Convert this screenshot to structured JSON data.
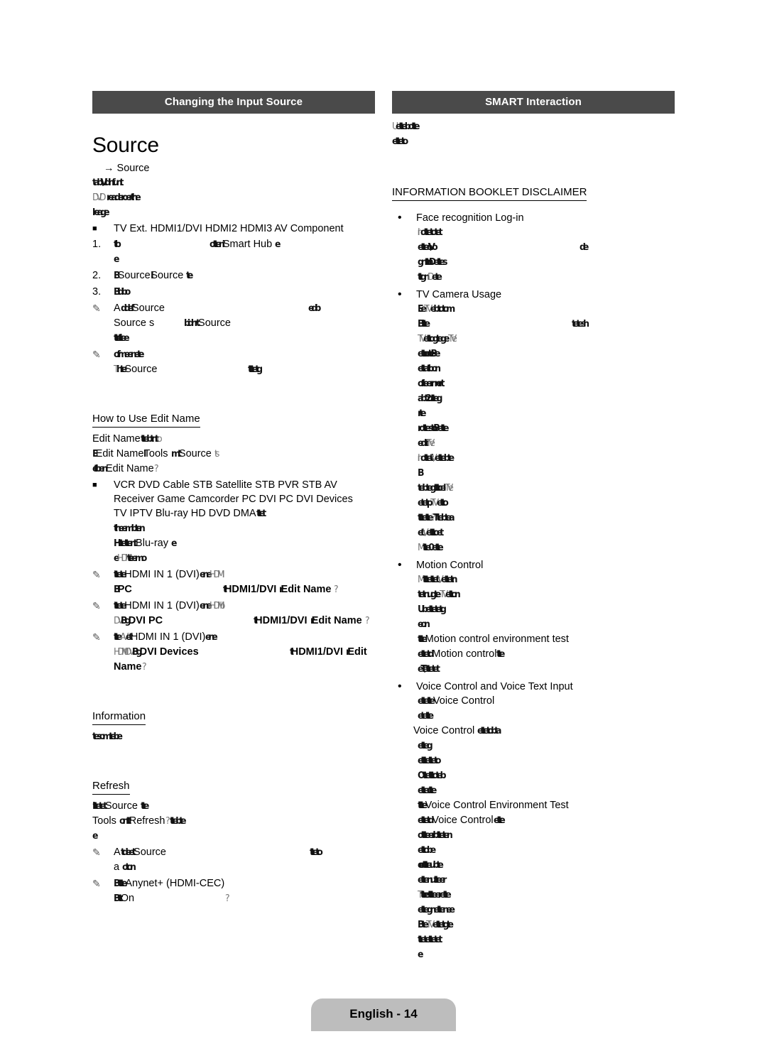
{
  "page": {
    "footer_label": "English - 14",
    "header_bg": "#4a4a4a",
    "footer_bg": "#bdbdbd"
  },
  "left_column": {
    "section_title": "Changing the Input Source",
    "page_title": "Source",
    "menu_path": "→ Source",
    "garbled_intro": [
      "tab\\Vidinfunt",
      "readeroerthe",
      "lreage"
    ],
    "garbled_intro_prefixes": [
      "",
      "DVD",
      ""
    ],
    "source_list_bullet": "■",
    "source_list": "TV  Ext.  HDMI1/DVI  HDMI2  HDMI3  AV      Component",
    "steps": [
      {
        "num": "1.",
        "text_before": "",
        "garble_a": "tb",
        "garble_b": "otteni",
        "text_mid": "Smart Hub",
        "garble_c": "e",
        "sub_garble": "e"
      },
      {
        "num": "2.",
        "garble_a": "B",
        "text_a": "Source",
        "garble_b": "I",
        "text_b": "Source",
        "garble_c": "te"
      },
      {
        "num": "3.",
        "garble_a": "Bidibo"
      }
    ],
    "notes": [
      {
        "icon": "pencil-icon",
        "line1_pre": "A",
        "line1_garble": "ddef",
        "line1_text": "Source",
        "line1_tail_garble": "edb",
        "line2_pre": "Source s",
        "line2_garble": "bidnrt",
        "line2_text": "Source",
        "line3_garble": "ttei ttee"
      },
      {
        "icon": "pencil-icon",
        "line1_garble": "ofmeenete",
        "line2_pre_garble": "T",
        "line2_garble": "hte",
        "line2_text": "Source",
        "line2_tail_garble": "tttetg"
      }
    ],
    "edit_name": {
      "heading": "How to Use Edit Name",
      "line1_text": "Edit Name",
      "line1_garble": "ttebtnt",
      "line1_tail": "o",
      "line2_garble_a": "E",
      "line2_text_a": "Edit Name",
      "line2_garble_b": "l",
      "line2_text_b": "Tools",
      "line2_garble_c": "mt",
      "line2_text_c": "Source",
      "line2_garble_d": "ts",
      "line3_garble_a": "el tben",
      "line3_text": "Edit Name",
      "line3_garble_b": "?",
      "bullet": "■",
      "device_lines": [
        "VCR  DVD  Cable STB  Satellite STB  PVR STB  AV",
        "Receiver  Game  Camcorder  PC  DVI PC  DVI Devices",
        "TV  IPTV  Blu-ray  HD DVD  DMA"
      ],
      "device_tail_garble": "ttet",
      "garble_after_1": "theembten",
      "garble_after_2_pre": "Httettent",
      "garble_after_2_text": "Blu-ray",
      "garble_after_2_tail": "e",
      "garble_after_3_pre": "e",
      "garble_after_3_text": "HDMI I",
      "garble_after_3_tail": "teemo"
    },
    "hdmi_notes": [
      {
        "icon": "pencil-icon",
        "l1_garble_a": "I",
        "l1_garble_b": "ttete",
        "l1_text_a": "HDMI IN 1 (DVI)",
        "l1_garble_c": "ene",
        "l1_text_b": "HDMI",
        "l2_garble_a": "B",
        "l2_text_a": "PC",
        "l2_garble_b": "t",
        "l2_text_b": "HDMI1/DVI",
        "l2_garble_c": "r",
        "l2_text_c": "Edit Name",
        "l2_garble_d": "?"
      },
      {
        "icon": "pencil-icon",
        "l1_garble_a": "I",
        "l1_garble_b": "ttete",
        "l1_text_a": "HDMI IN 1 (DVI)",
        "l1_garble_c": "ene",
        "l1_text_b": "HDMI b",
        "l2_garble_a": "DVI",
        "l2_garble_b": "Bg",
        "l2_text_a": "DVI PC",
        "l2_garble_c": "t",
        "l2_text_b": "HDMI1/DVI",
        "l2_garble_c2": "r",
        "l2_text_c": "Edit Name",
        "l2_garble_d": "?"
      },
      {
        "icon": "pencil-icon",
        "l1_garble_a": "I",
        "l1_garble_b": "tte",
        "l1_garble_c": "AV",
        "l1_garble_d": "et",
        "l1_text_a": "HDMI IN 1 (DVI)",
        "l1_garble_e": "ene",
        "l2_text_a": "HDMI t",
        "l2_garble_a": "DVI",
        "l2_garble_b": "Bg",
        "l2_text_b": "DVI Devices",
        "l2_garble_c": "t",
        "l2_text_c": "HDMI1/DVI",
        "l2_garble_d": "r",
        "l2_text_d": "Edit",
        "l3_text": "Name",
        "l3_garble": "?"
      }
    ],
    "information": {
      "heading": "Information",
      "garble": "tesomtebe"
    },
    "refresh": {
      "heading": "Refresh",
      "l1_garble_a": "Ittetet",
      "l1_text_a": "Source",
      "l1_garble_b": "tte",
      "l2_text_a": "Tools",
      "l2_garble_a": "ontt",
      "l2_text_b": "Refresh",
      "l2_garble_b": "?",
      "l2_garble_c": "ttebte",
      "l3_garble": "e",
      "notes": [
        {
          "icon": "pencil-icon",
          "l1_pre": "A",
          "l1_garble": "tdeet",
          "l1_text": "Source",
          "l1_tail_garble": "tteto",
          "l2_pre": "a",
          "l2_garble": "oton"
        },
        {
          "icon": "pencil-icon",
          "l1_garble": "Bttte",
          "l1_text": "Anynet+ (HDMI-CEC)",
          "l2_garble_a": "Btt",
          "l2_text": "On",
          "l2_garble_b": "?"
        }
      ]
    }
  },
  "right_column": {
    "section_title": "SMART Interaction",
    "intro": {
      "l1_pre": "U",
      "l1_garble": "ettebotte",
      "l2_garble": "etteto"
    },
    "disclaimer_heading": "INFORMATION BOOKLET DISCLAIMER",
    "items": [
      {
        "bullet": "•",
        "label": "Face recognition Log-in",
        "lines": [
          {
            "pre": "In",
            "garble": "ottetotet"
          },
          {
            "garble": "etteo \\Vo",
            "tail_spacer": true,
            "tail_garble": "de"
          },
          {
            "garble": "gnttn Dettes"
          },
          {
            "garble": "ttgn",
            "mid_light": "D",
            "tail_garble": "ete"
          }
        ]
      },
      {
        "bullet": "•",
        "label": "TV Camera Usage",
        "lines": [
          {
            "garble": "Ee",
            "light_mid": "TV",
            "garble2": "ebtotom"
          },
          {
            "garble": "Bitte",
            "tail_spacer": true,
            "tail_garble": "tetesh"
          },
          {
            "light_pre": "TV",
            "garble": "ettogtege",
            "light_tail": "TV e"
          },
          {
            "garble": "etto ete Be"
          },
          {
            "garble": "ettatbon"
          },
          {
            "garble": "ofteernn ert"
          },
          {
            "garble": "abt2 utteg"
          },
          {
            "garble": "rte"
          },
          {
            "garble": "rottesto Bette"
          },
          {
            "garble": "edti",
            "light_tail": "TV e"
          },
          {
            "light_pre": "In",
            "garble": "otteti",
            "light_tail2": "\\V",
            "garble2": "ettebte"
          },
          {
            "garble": "B"
          },
          {
            "garble": "tebtegtttcel",
            "light_tail": "TV e"
          },
          {
            "garble": "etetp",
            "light_tail": "TV",
            "garble2": "etto"
          },
          {
            "garble": "tttette",
            "mid": "?",
            "garble2": "Ttebtea"
          },
          {
            "garble": "et",
            "light_mid": "\\V",
            "garble2": "etttoet"
          },
          {
            "light_pre": "M",
            "garble": "tte0ette"
          }
        ]
      },
      {
        "bullet": "•",
        "label": "Motion Control",
        "lines": [
          {
            "light_pre": "M",
            "garble": "tttettet",
            "light_tail": "\\V",
            "garble2": "ettetn"
          },
          {
            "garble": "tetnugte",
            "light_tail": "TV",
            "garble2": "etton"
          },
          {
            "garble": "Ubettetetg"
          },
          {
            "garble": "eon"
          },
          {
            "garble": "ttte",
            "text": "Motion control environment test"
          },
          {
            "garble": "ettetd",
            "text": "Motion control",
            "tail_garble": "tte"
          },
          {
            "garble": "eT \\ettetet"
          }
        ]
      },
      {
        "bullet": "•",
        "label": "Voice Control and Voice Text Input",
        "lines": [
          {
            "garble": "ettette",
            "text": "Voice Control"
          },
          {
            "garble": "etette"
          },
          {
            "text": "Voice Control",
            "garble_after": "ettetobta"
          },
          {
            "garble": "etteg"
          },
          {
            "garble": "etttetteto"
          },
          {
            "garble": "Ottetttoteb"
          },
          {
            "garble": "etteu tte"
          },
          {
            "garble": "ttte",
            "text": "Voice Control Environment Test"
          },
          {
            "garble": "ettetd",
            "text": "Voice Control",
            "tail_garble": "ette"
          },
          {
            "garble": "ottteerbtteten"
          },
          {
            "garble": "ettobe"
          },
          {
            "garble": "o ettteubte"
          },
          {
            "garble": "ettenutteer"
          },
          {
            "light_pre": "T",
            "garble": "tte ettteerette"
          },
          {
            "garble": "ettegnettenee"
          },
          {
            "garble": "Bte",
            "light_mid": "TV",
            "garble2": "ettetgte"
          },
          {
            "garble": "ttetettetet"
          },
          {
            "garble": "e"
          }
        ]
      }
    ]
  }
}
